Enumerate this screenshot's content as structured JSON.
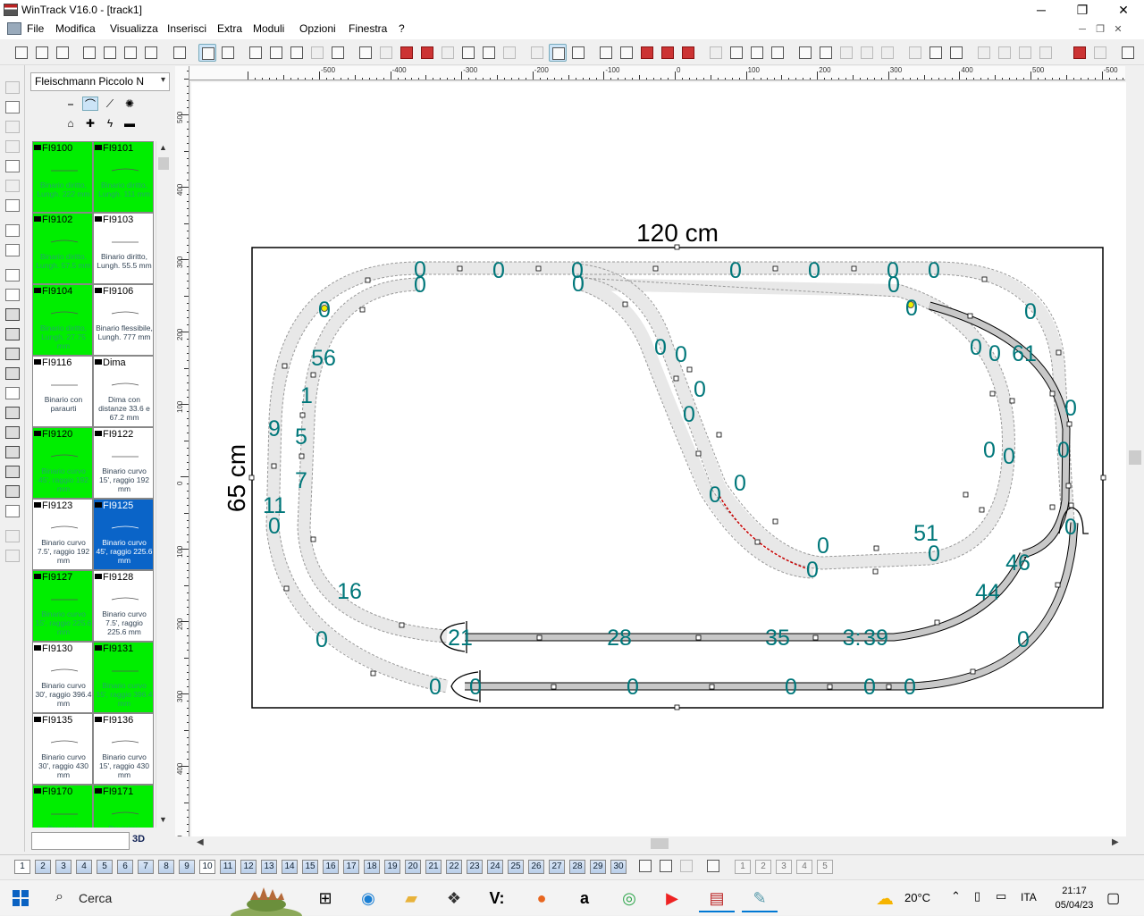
{
  "window": {
    "title": "WinTrack  V16.0 - [track1]",
    "min": "─",
    "max": "❐",
    "close": "✕"
  },
  "menu": [
    "File",
    "Modifica",
    "Visualizza",
    "Inserisci",
    "Extra",
    "Moduli",
    "Opzioni",
    "Finestra",
    "?"
  ],
  "catalog": {
    "selected": "Fleischmann Piccolo N",
    "search_value": "",
    "btn3d": "3D",
    "pieces": [
      {
        "code": "FI9100",
        "desc": "Binario diritto, Lungh. 222 mm",
        "color": "green"
      },
      {
        "code": "FI9101",
        "desc": "Binario diritto, Lungh. 111 mm",
        "color": "green"
      },
      {
        "code": "FI9102",
        "desc": "Binario diritto, Lungh. 57.5 mm",
        "color": "green"
      },
      {
        "code": "FI9103",
        "desc": "Binario diritto, Lungh. 55.5 mm",
        "color": "white"
      },
      {
        "code": "FI9104",
        "desc": "Binario diritto, Lungh. 27.75 mm",
        "color": "green"
      },
      {
        "code": "FI9106",
        "desc": "Binario flessibile, Lungh. 777 mm",
        "color": "white"
      },
      {
        "code": "FI9116",
        "desc": "Binario con paraurti",
        "color": "white"
      },
      {
        "code": "Dima",
        "desc": "Dima con distanze 33.6 e 67.2 mm",
        "color": "white"
      },
      {
        "code": "FI9120",
        "desc": "Binario curvo 45', raggio 192 mm",
        "color": "green"
      },
      {
        "code": "FI9122",
        "desc": "Binario curvo 15', raggio 192 mm",
        "color": "white"
      },
      {
        "code": "FI9123",
        "desc": "Binario curvo 7.5', raggio 192 mm",
        "color": "white"
      },
      {
        "code": "FI9125",
        "desc": "Binario curvo 45', raggio 225.6 mm",
        "color": "blue"
      },
      {
        "code": "FI9127",
        "desc": "Binario curvo 15', raggio 225.6 mm",
        "color": "green"
      },
      {
        "code": "FI9128",
        "desc": "Binario curvo 7.5', raggio 225.6 mm",
        "color": "white"
      },
      {
        "code": "FI9130",
        "desc": "Binario curvo 30', raggio 396.4 mm",
        "color": "white"
      },
      {
        "code": "FI9131",
        "desc": "Binario curvo 15', raggio 396.4 mm",
        "color": "green"
      },
      {
        "code": "FI9135",
        "desc": "Binario curvo 30', raggio 430 mm",
        "color": "white"
      },
      {
        "code": "FI9136",
        "desc": "Binario curvo 15', raggio 430 mm",
        "color": "white"
      },
      {
        "code": "FI9170",
        "desc": "Deviatoio",
        "color": "green"
      },
      {
        "code": "FI9171",
        "desc": "Deviatoio",
        "color": "green"
      }
    ]
  },
  "rulers": {
    "h_labels": [
      "-500",
      "-400",
      "-300",
      "-200",
      "-100",
      "0",
      "100",
      "200",
      "300",
      "400",
      "500"
    ],
    "h_partial": "-500",
    "v_labels": [
      "500",
      "400",
      "300",
      "200",
      "100",
      "0",
      "100",
      "200",
      "300",
      "400",
      "500"
    ]
  },
  "layout": {
    "width_label": "120 cm",
    "height_label": "65 cm",
    "labels": [
      "0",
      "0",
      "0",
      "0",
      "0",
      "0",
      "0",
      "0",
      "0",
      "0",
      "0",
      "0",
      "61",
      "0",
      "56",
      "1",
      "5",
      "7",
      "9",
      "11",
      "0",
      "0",
      "0",
      "0",
      "0",
      "0",
      "0",
      "0",
      "0",
      "0",
      "0",
      "0",
      "0",
      "0",
      "51",
      "0",
      "0",
      "0",
      "16",
      "46",
      "44",
      "0",
      "21",
      "28",
      "35",
      "3:",
      "39",
      "0",
      "0",
      "0",
      "0",
      "0",
      "0",
      "0",
      "0"
    ]
  },
  "layers": [
    "1",
    "2",
    "3",
    "4",
    "5",
    "6",
    "7",
    "8",
    "9",
    "10",
    "11",
    "12",
    "13",
    "14",
    "15",
    "16",
    "17",
    "18",
    "19",
    "20",
    "21",
    "22",
    "23",
    "24",
    "25",
    "26",
    "27",
    "28",
    "29",
    "30"
  ],
  "views": [
    "1",
    "2",
    "3",
    "4",
    "5"
  ],
  "taskbar": {
    "search": "Cerca",
    "temp": "20°C",
    "lang": "ITA",
    "time": "21:17",
    "date": "05/04/23",
    "apps": [
      "task-view",
      "edge",
      "explorer",
      "dropbox",
      "vectorworks",
      "firefox",
      "amazon",
      "chrome",
      "youtube",
      "wintrack",
      "paint"
    ]
  },
  "colors": {
    "accent": "#0078d4",
    "catalog_green": "#00ee00",
    "catalog_selected": "#0a64c8",
    "label_teal": "#00777a",
    "selected_track": "#cc0000"
  }
}
